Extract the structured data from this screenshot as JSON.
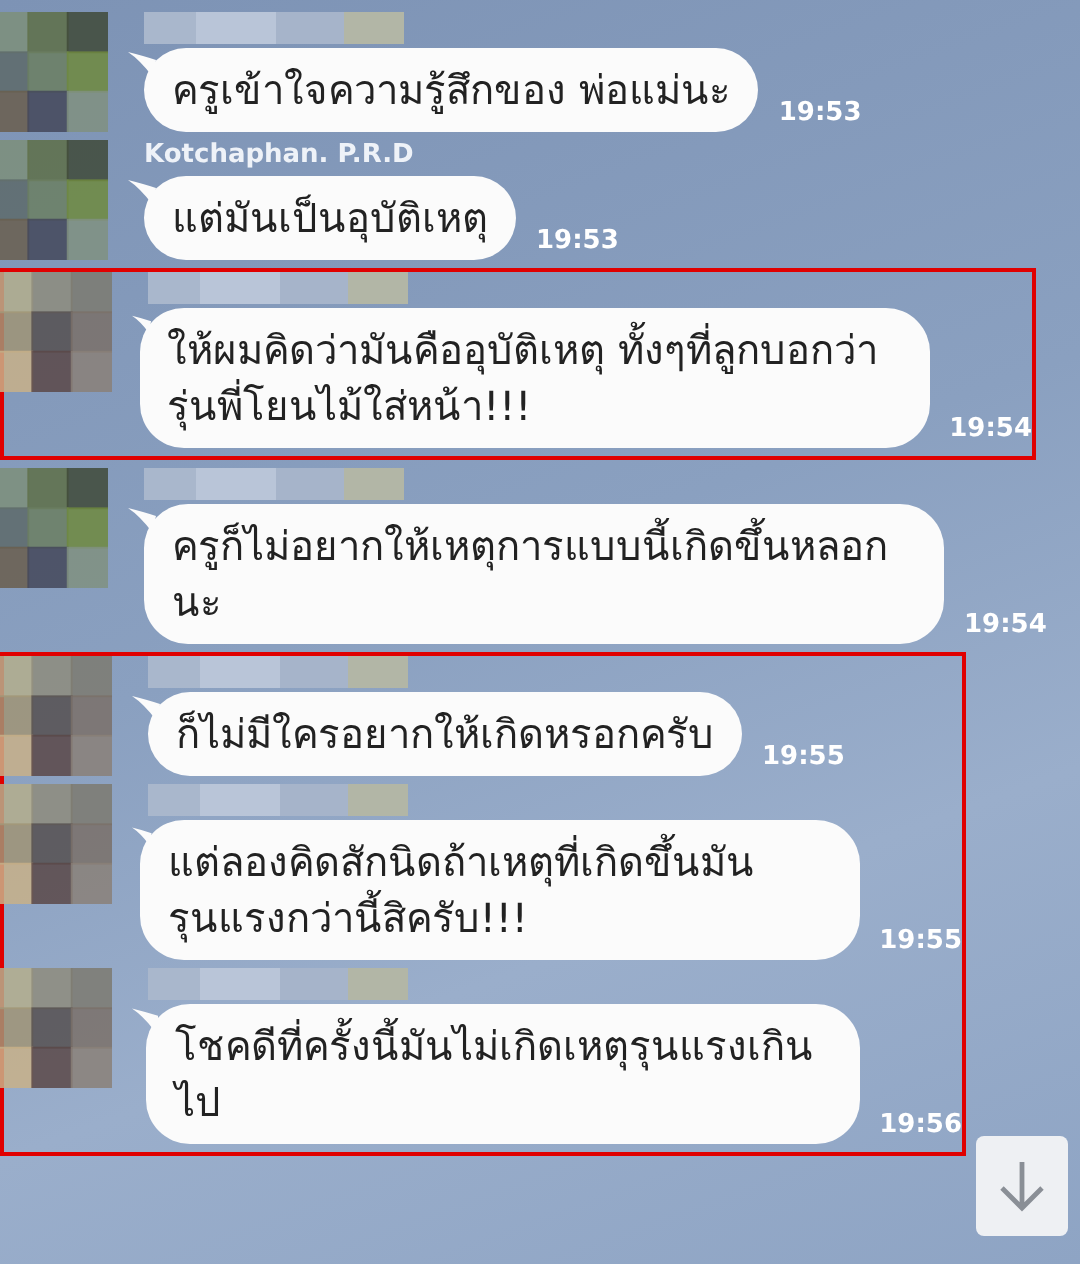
{
  "chat": [
    {
      "kind": "message",
      "text": "ครูเข้าใจความรู้สึกของ พ่อแม่นะ",
      "time": "19:53"
    },
    {
      "kind": "message",
      "name": "Kotchaphan. P.R.D",
      "text": "แต่มันเป็นอุบัติเหตุ",
      "time": "19:53"
    },
    {
      "kind": "highlight",
      "messages": [
        {
          "kind": "message",
          "text": "ให้ผมคิดว่ามันคืออุบัติเหตุ ทั้งๆที่ลูกบอกว่ารุ่นพี่โยนไม้ใส่หน้า!!!",
          "time": "19:54"
        }
      ]
    },
    {
      "kind": "message",
      "text": "ครูก็ไม่อยากให้เหตุการแบบนี้เกิดขึ้นหลอกนะ",
      "time": "19:54"
    },
    {
      "kind": "highlight",
      "messages": [
        {
          "kind": "message",
          "text": "ก็ไม่มีใครอยากให้เกิดหรอกครับ",
          "time": "19:55"
        },
        {
          "kind": "message",
          "text": "แต่ลองคิดสักนิดถ้าเหตุที่เกิดขึ้นมันรุนแรงกว่านี้สิครับ!!!",
          "time": "19:55"
        },
        {
          "kind": "message",
          "text": "โชคดีที่ครั้งนี้มันไม่เกิดเหตุรุนแรงเกินไป",
          "time": "19:56"
        }
      ]
    }
  ]
}
